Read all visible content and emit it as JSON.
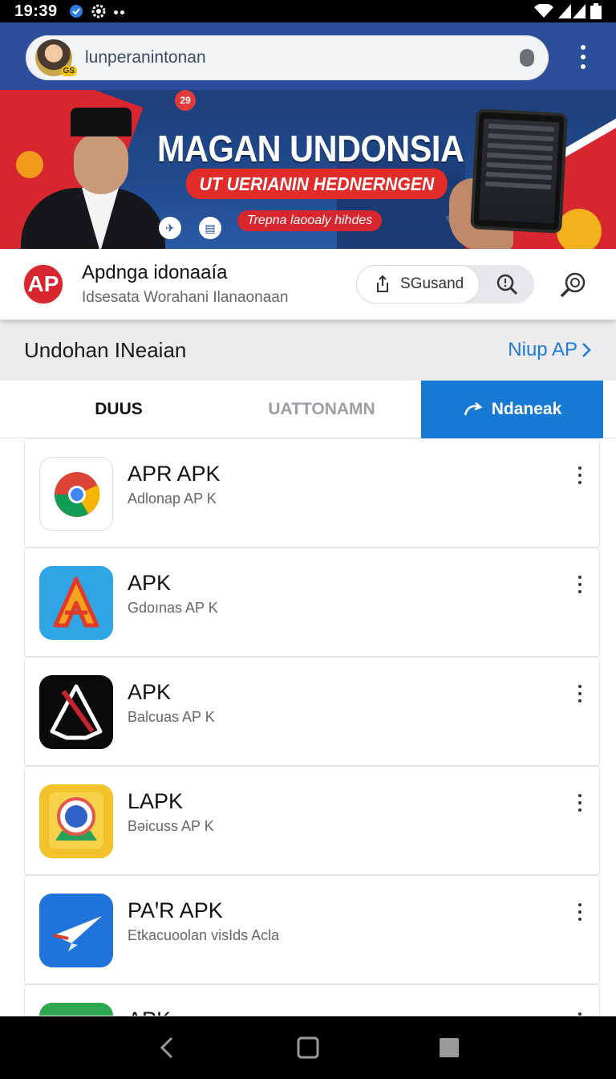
{
  "status_bar": {
    "time": "19:39",
    "icons_left": [
      "notification-icon",
      "settings-gear-icon",
      "more-dots-icon"
    ],
    "icons_right": [
      "wifi-icon",
      "signal-icon",
      "battery-icon"
    ]
  },
  "search": {
    "query": "lunperanintonan",
    "avatar_badge": "GS",
    "icons": [
      "avatar",
      "mic-icon",
      "overflow-menu-icon"
    ]
  },
  "banner": {
    "title": "MAGAN UNDONSIA",
    "subtitle": "UT UERIANIN HEDNERNGEN",
    "tagline": "Trepna laooaly hihdes",
    "chips": [
      "29"
    ]
  },
  "app_card": {
    "logo_text": "AP",
    "name": "Apdnga idonaaía",
    "description": "Idsesata Worahani Ilanaonaan",
    "share_button_label": "SGusand",
    "icons": [
      "share-icon",
      "search-icon",
      "search-icon-outline"
    ]
  },
  "section": {
    "title": "Undohan INeaian",
    "link_label": "Niup AP"
  },
  "tabs": [
    {
      "label": "DUUS",
      "selected": false
    },
    {
      "label": "UATTONAMN",
      "selected": false
    },
    {
      "label": "Ndaneak",
      "selected": true,
      "icon": "refresh-arrow-icon"
    }
  ],
  "list": {
    "items": [
      {
        "title": "APR APK",
        "subtitle": "Adlonap AP K",
        "icon": "chrome-icon"
      },
      {
        "title": "APK",
        "subtitle": "Gdoınas AP K",
        "icon": "a-logo-icon"
      },
      {
        "title": "APK",
        "subtitle": "Balcuas AP K",
        "icon": "dark-a-logo-icon"
      },
      {
        "title": "LAPK",
        "subtitle": "Bəicuss AP K",
        "icon": "photo-lens-icon"
      },
      {
        "title": "PAꞌR APK",
        "subtitle": "Etkacuoolan visIds  Acla",
        "icon": "paper-plane-icon"
      },
      {
        "title": "APK",
        "subtitle": "",
        "icon": "green-app-icon"
      }
    ]
  },
  "nav_bar": {
    "buttons": [
      "back-icon",
      "home-icon",
      "recents-icon"
    ]
  },
  "colors": {
    "header_blue": "#2c4f9c",
    "accent_blue": "#1679d3",
    "brand_red": "#d8262e"
  }
}
